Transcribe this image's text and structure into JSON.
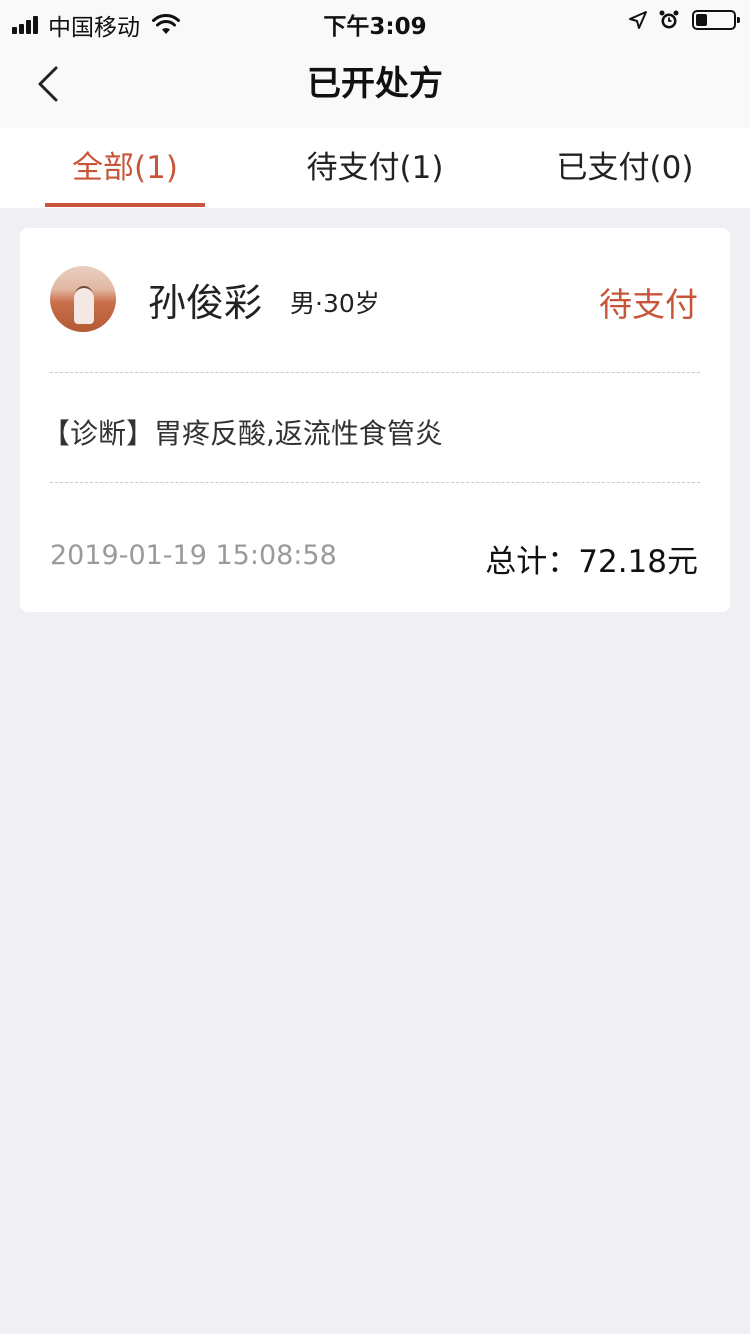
{
  "status_bar": {
    "carrier": "中国移动",
    "time": "下午3:09",
    "battery_level": 0.3,
    "icons": [
      "signal-icon",
      "wifi-icon",
      "location-icon",
      "alarm-icon",
      "battery-icon"
    ]
  },
  "nav": {
    "title": "已开处方",
    "back_icon": "chevron-left-icon"
  },
  "tabs": [
    {
      "label": "全部(1)",
      "active": true
    },
    {
      "label": "待支付(1)",
      "active": false
    },
    {
      "label": "已支付(0)",
      "active": false
    }
  ],
  "prescriptions": [
    {
      "name": "孙俊彩",
      "gender_age": "男·30岁",
      "status": "待支付",
      "diagnosis": "【诊断】胃疼反酸,返流性食管炎",
      "datetime": "2019-01-19 15:08:58",
      "total": "总计：72.18元"
    }
  ],
  "colors": {
    "accent": "#c8553a",
    "background": "#efeff4",
    "card": "#ffffff",
    "muted_text": "#9a9a9a"
  }
}
